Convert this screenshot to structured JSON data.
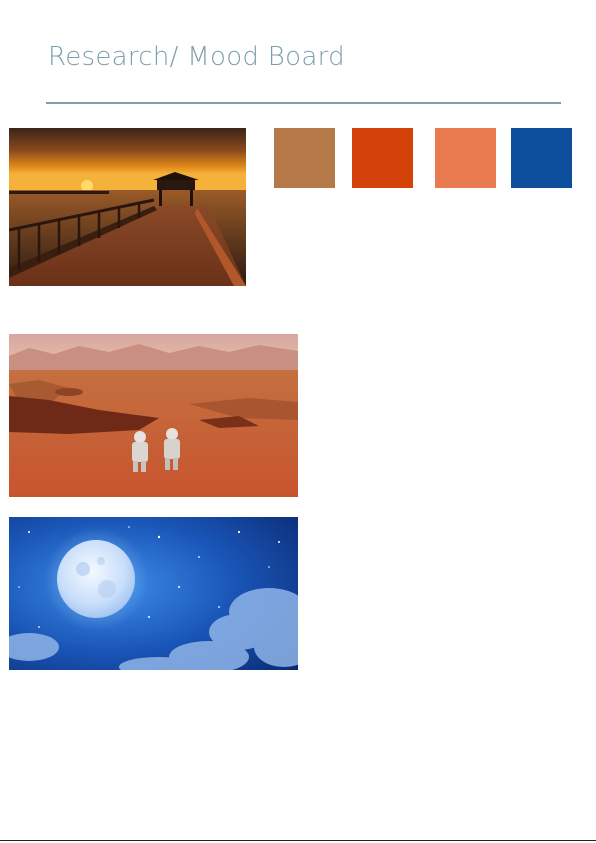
{
  "page": {
    "title": "Research/ Mood Board",
    "accent_color": "#7b9fae"
  },
  "images": [
    {
      "subject": "sunset-pier"
    },
    {
      "subject": "astronauts-on-mars"
    },
    {
      "subject": "moon-in-starry-sky"
    }
  ],
  "palette": {
    "swatches": [
      "#b57a48",
      "#d4420a",
      "#ea7a4f",
      "#0d4f9c"
    ]
  }
}
